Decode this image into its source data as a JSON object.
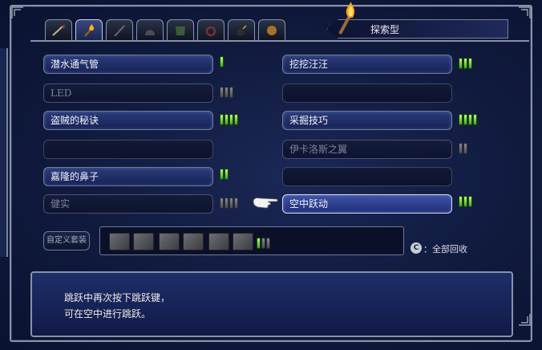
{
  "header": {
    "category": "探索型"
  },
  "tabs": [
    {
      "icon": "sword-icon"
    },
    {
      "icon": "torch-icon",
      "active": true
    },
    {
      "icon": "staff-icon"
    },
    {
      "icon": "helmet-icon"
    },
    {
      "icon": "armor-icon"
    },
    {
      "icon": "ring-icon"
    },
    {
      "icon": "bomb-icon"
    },
    {
      "icon": "orb-icon"
    }
  ],
  "skills": {
    "left": [
      {
        "label": "潜水通气管",
        "state": "on",
        "pips": 1
      },
      {
        "label": "LED",
        "state": "dim",
        "pips": 3
      },
      {
        "label": "盗贼的秘诀",
        "state": "on",
        "pips": 4
      },
      {
        "label": "",
        "state": "empty",
        "pips": 0
      },
      {
        "label": "嘉隆的鼻子",
        "state": "on",
        "pips": 2
      },
      {
        "label": "健实",
        "state": "dim",
        "pips": 4
      }
    ],
    "right": [
      {
        "label": "挖挖汪汪",
        "state": "on",
        "pips": 3
      },
      {
        "label": "",
        "state": "empty",
        "pips": 0
      },
      {
        "label": "采掘技巧",
        "state": "on",
        "pips": 4
      },
      {
        "label": "伊卡洛斯之翼",
        "state": "dim",
        "pips": 2
      },
      {
        "label": "",
        "state": "empty",
        "pips": 0
      },
      {
        "label": "空中跃动",
        "state": "selected",
        "pips": 3
      }
    ]
  },
  "custom_set_label": "自定义套装",
  "reset": {
    "key": "C",
    "label": "：全部回收"
  },
  "description": {
    "line1": "跳跃中再次按下跳跃键，",
    "line2": "可在空中进行跳跃。"
  },
  "colors": {
    "pip_on": "#5cd028",
    "panel_bg": "#101a3d",
    "selected": "#2f44a0"
  }
}
